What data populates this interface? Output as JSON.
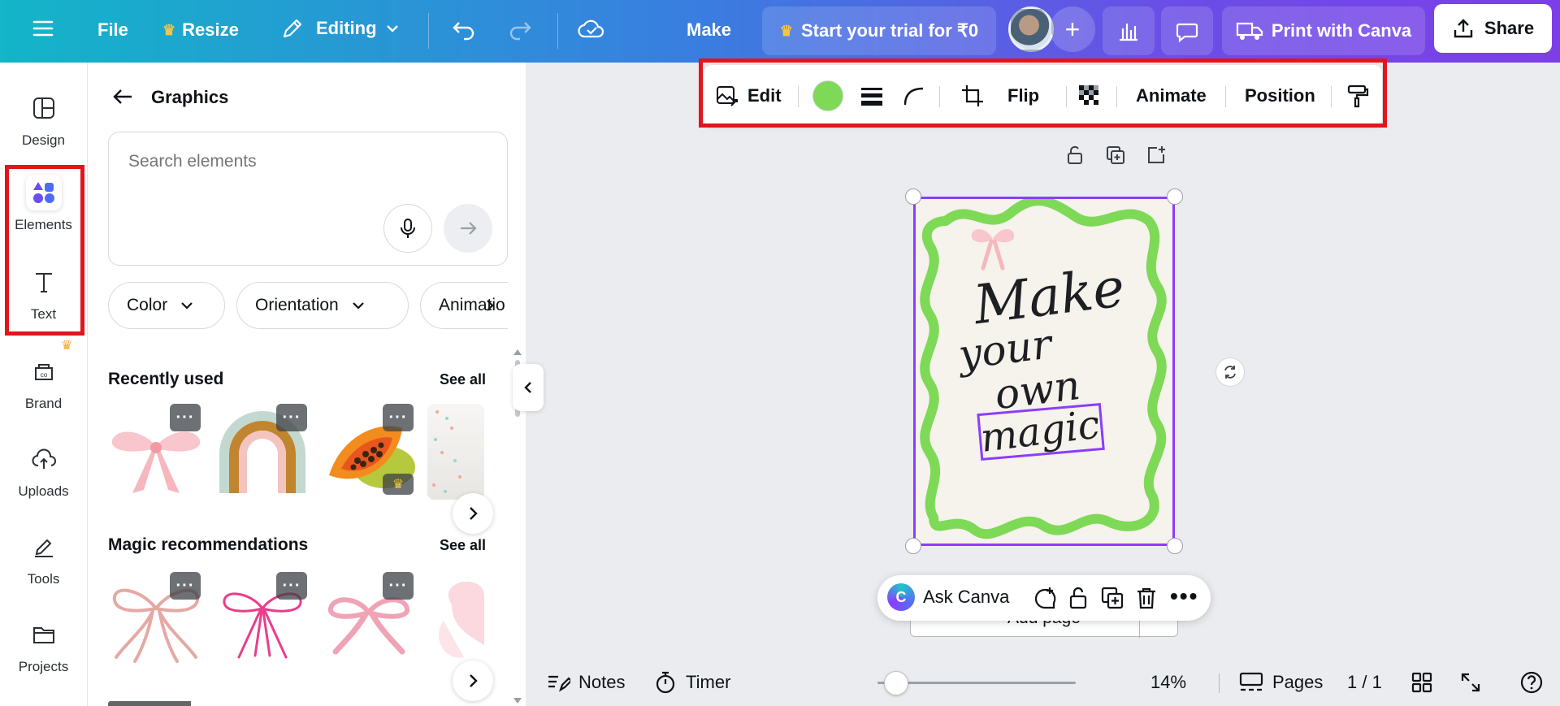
{
  "topbar": {
    "file_label": "File",
    "resize_label": "Resize",
    "editing_label": "Editing",
    "make_label": "Make",
    "trial_label": "Start your trial for ₹0",
    "print_label": "Print with Canva",
    "share_label": "Share"
  },
  "rail": {
    "items": [
      {
        "label": "Design",
        "icon": "design-icon"
      },
      {
        "label": "Elements",
        "icon": "elements-icon"
      },
      {
        "label": "Text",
        "icon": "text-icon"
      },
      {
        "label": "Brand",
        "icon": "brand-icon"
      },
      {
        "label": "Uploads",
        "icon": "uploads-icon"
      },
      {
        "label": "Tools",
        "icon": "tools-icon"
      },
      {
        "label": "Projects",
        "icon": "projects-icon"
      }
    ]
  },
  "panel": {
    "title": "Graphics",
    "search_placeholder": "Search elements",
    "filters": [
      "Color",
      "Orientation",
      "Animatio"
    ],
    "recently_used": {
      "title": "Recently used",
      "see_all": "See all"
    },
    "magic": {
      "title": "Magic recommendations",
      "see_all": "See all"
    }
  },
  "context_toolbar": {
    "edit_label": "Edit",
    "flip_label": "Flip",
    "animate_label": "Animate",
    "position_label": "Position",
    "fill_color": "#7ed957"
  },
  "design": {
    "line1": "Make",
    "line2": "your",
    "line3": "own",
    "line4": "magic",
    "wave_color": "#7ed957",
    "frame_color": "#8b3dff"
  },
  "floating_bar": {
    "ask_label": "Ask Canva"
  },
  "add_page_label": "Add page",
  "bottombar": {
    "notes_label": "Notes",
    "timer_label": "Timer",
    "zoom_label": "14%",
    "zoom_level": 0.14,
    "pages_label": "Pages",
    "page_count": "1 / 1"
  },
  "colors": {
    "highlight": "#e3141c",
    "accent": "#8b3dff",
    "crown": "#f5a623"
  }
}
